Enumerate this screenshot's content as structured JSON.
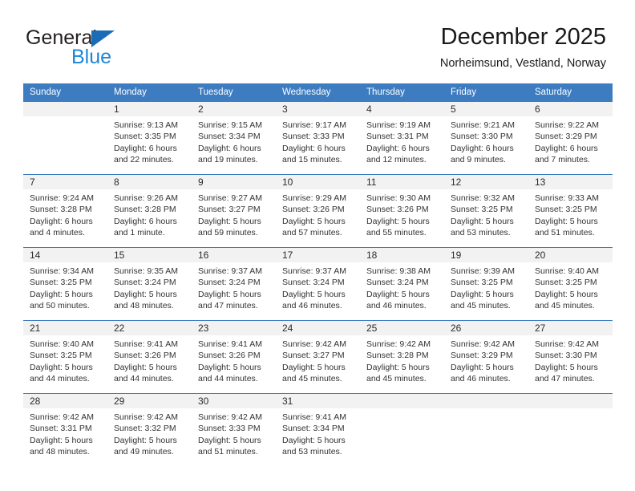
{
  "brand": {
    "name_top": "General",
    "name_bottom": "Blue",
    "triangle_color": "#1c6cb5",
    "blue_color": "#1c86d8"
  },
  "header": {
    "title": "December 2025",
    "subtitle": "Norheimsund, Vestland, Norway"
  },
  "theme": {
    "header_blue": "#3d7cc0",
    "day_band_gray": "#f2f2f2",
    "text": "#333333"
  },
  "weekdays": [
    "Sunday",
    "Monday",
    "Tuesday",
    "Wednesday",
    "Thursday",
    "Friday",
    "Saturday"
  ],
  "weeks": [
    [
      {
        "day": "",
        "lines": [
          "",
          "",
          "",
          ""
        ]
      },
      {
        "day": "1",
        "lines": [
          "Sunrise: 9:13 AM",
          "Sunset: 3:35 PM",
          "Daylight: 6 hours",
          "and 22 minutes."
        ]
      },
      {
        "day": "2",
        "lines": [
          "Sunrise: 9:15 AM",
          "Sunset: 3:34 PM",
          "Daylight: 6 hours",
          "and 19 minutes."
        ]
      },
      {
        "day": "3",
        "lines": [
          "Sunrise: 9:17 AM",
          "Sunset: 3:33 PM",
          "Daylight: 6 hours",
          "and 15 minutes."
        ]
      },
      {
        "day": "4",
        "lines": [
          "Sunrise: 9:19 AM",
          "Sunset: 3:31 PM",
          "Daylight: 6 hours",
          "and 12 minutes."
        ]
      },
      {
        "day": "5",
        "lines": [
          "Sunrise: 9:21 AM",
          "Sunset: 3:30 PM",
          "Daylight: 6 hours",
          "and 9 minutes."
        ]
      },
      {
        "day": "6",
        "lines": [
          "Sunrise: 9:22 AM",
          "Sunset: 3:29 PM",
          "Daylight: 6 hours",
          "and 7 minutes."
        ]
      }
    ],
    [
      {
        "day": "7",
        "lines": [
          "Sunrise: 9:24 AM",
          "Sunset: 3:28 PM",
          "Daylight: 6 hours",
          "and 4 minutes."
        ]
      },
      {
        "day": "8",
        "lines": [
          "Sunrise: 9:26 AM",
          "Sunset: 3:28 PM",
          "Daylight: 6 hours",
          "and 1 minute."
        ]
      },
      {
        "day": "9",
        "lines": [
          "Sunrise: 9:27 AM",
          "Sunset: 3:27 PM",
          "Daylight: 5 hours",
          "and 59 minutes."
        ]
      },
      {
        "day": "10",
        "lines": [
          "Sunrise: 9:29 AM",
          "Sunset: 3:26 PM",
          "Daylight: 5 hours",
          "and 57 minutes."
        ]
      },
      {
        "day": "11",
        "lines": [
          "Sunrise: 9:30 AM",
          "Sunset: 3:26 PM",
          "Daylight: 5 hours",
          "and 55 minutes."
        ]
      },
      {
        "day": "12",
        "lines": [
          "Sunrise: 9:32 AM",
          "Sunset: 3:25 PM",
          "Daylight: 5 hours",
          "and 53 minutes."
        ]
      },
      {
        "day": "13",
        "lines": [
          "Sunrise: 9:33 AM",
          "Sunset: 3:25 PM",
          "Daylight: 5 hours",
          "and 51 minutes."
        ]
      }
    ],
    [
      {
        "day": "14",
        "lines": [
          "Sunrise: 9:34 AM",
          "Sunset: 3:25 PM",
          "Daylight: 5 hours",
          "and 50 minutes."
        ]
      },
      {
        "day": "15",
        "lines": [
          "Sunrise: 9:35 AM",
          "Sunset: 3:24 PM",
          "Daylight: 5 hours",
          "and 48 minutes."
        ]
      },
      {
        "day": "16",
        "lines": [
          "Sunrise: 9:37 AM",
          "Sunset: 3:24 PM",
          "Daylight: 5 hours",
          "and 47 minutes."
        ]
      },
      {
        "day": "17",
        "lines": [
          "Sunrise: 9:37 AM",
          "Sunset: 3:24 PM",
          "Daylight: 5 hours",
          "and 46 minutes."
        ]
      },
      {
        "day": "18",
        "lines": [
          "Sunrise: 9:38 AM",
          "Sunset: 3:24 PM",
          "Daylight: 5 hours",
          "and 46 minutes."
        ]
      },
      {
        "day": "19",
        "lines": [
          "Sunrise: 9:39 AM",
          "Sunset: 3:25 PM",
          "Daylight: 5 hours",
          "and 45 minutes."
        ]
      },
      {
        "day": "20",
        "lines": [
          "Sunrise: 9:40 AM",
          "Sunset: 3:25 PM",
          "Daylight: 5 hours",
          "and 45 minutes."
        ]
      }
    ],
    [
      {
        "day": "21",
        "lines": [
          "Sunrise: 9:40 AM",
          "Sunset: 3:25 PM",
          "Daylight: 5 hours",
          "and 44 minutes."
        ]
      },
      {
        "day": "22",
        "lines": [
          "Sunrise: 9:41 AM",
          "Sunset: 3:26 PM",
          "Daylight: 5 hours",
          "and 44 minutes."
        ]
      },
      {
        "day": "23",
        "lines": [
          "Sunrise: 9:41 AM",
          "Sunset: 3:26 PM",
          "Daylight: 5 hours",
          "and 44 minutes."
        ]
      },
      {
        "day": "24",
        "lines": [
          "Sunrise: 9:42 AM",
          "Sunset: 3:27 PM",
          "Daylight: 5 hours",
          "and 45 minutes."
        ]
      },
      {
        "day": "25",
        "lines": [
          "Sunrise: 9:42 AM",
          "Sunset: 3:28 PM",
          "Daylight: 5 hours",
          "and 45 minutes."
        ]
      },
      {
        "day": "26",
        "lines": [
          "Sunrise: 9:42 AM",
          "Sunset: 3:29 PM",
          "Daylight: 5 hours",
          "and 46 minutes."
        ]
      },
      {
        "day": "27",
        "lines": [
          "Sunrise: 9:42 AM",
          "Sunset: 3:30 PM",
          "Daylight: 5 hours",
          "and 47 minutes."
        ]
      }
    ],
    [
      {
        "day": "28",
        "lines": [
          "Sunrise: 9:42 AM",
          "Sunset: 3:31 PM",
          "Daylight: 5 hours",
          "and 48 minutes."
        ]
      },
      {
        "day": "29",
        "lines": [
          "Sunrise: 9:42 AM",
          "Sunset: 3:32 PM",
          "Daylight: 5 hours",
          "and 49 minutes."
        ]
      },
      {
        "day": "30",
        "lines": [
          "Sunrise: 9:42 AM",
          "Sunset: 3:33 PM",
          "Daylight: 5 hours",
          "and 51 minutes."
        ]
      },
      {
        "day": "31",
        "lines": [
          "Sunrise: 9:41 AM",
          "Sunset: 3:34 PM",
          "Daylight: 5 hours",
          "and 53 minutes."
        ]
      },
      {
        "day": "",
        "lines": [
          "",
          "",
          "",
          ""
        ]
      },
      {
        "day": "",
        "lines": [
          "",
          "",
          "",
          ""
        ]
      },
      {
        "day": "",
        "lines": [
          "",
          "",
          "",
          ""
        ]
      }
    ]
  ]
}
